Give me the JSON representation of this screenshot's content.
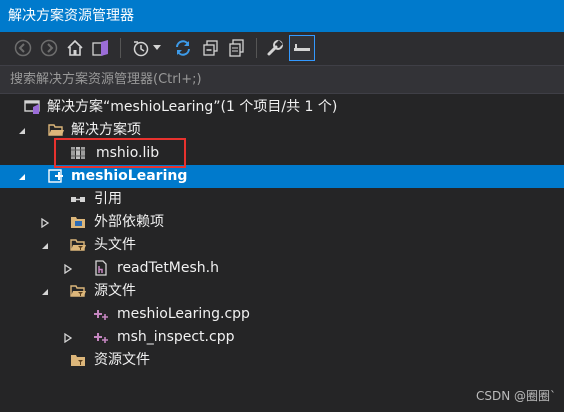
{
  "window": {
    "title": "解决方案资源管理器"
  },
  "toolbar": {
    "buttons": [
      {
        "icon": "back-icon"
      },
      {
        "icon": "forward-icon"
      },
      {
        "icon": "home-icon"
      },
      {
        "icon": "vs-switch-views-icon"
      },
      {
        "icon": "pending-changes-filter-icon"
      },
      {
        "icon": "dropdown-arrow-icon"
      },
      {
        "icon": "sync-icon"
      },
      {
        "icon": "collapse-all-icon"
      },
      {
        "icon": "show-all-files-icon"
      },
      {
        "icon": "properties-wrench-icon"
      },
      {
        "icon": "preview-icon"
      }
    ]
  },
  "search": {
    "placeholder": "搜索解决方案资源管理器(Ctrl+;)"
  },
  "tree": {
    "solution": "解决方案“meshioLearing”(1 个项目/共 1 个)",
    "solution_items_folder": "解决方案项",
    "lib_file": "mshio.lib",
    "project": "meshioLearing",
    "references": "引用",
    "external_deps": "外部依赖项",
    "header_files": "头文件",
    "header_1": "readTetMesh.h",
    "source_files": "源文件",
    "source_1": "meshioLearing.cpp",
    "source_2": "msh_inspect.cpp",
    "resource_files": "资源文件"
  },
  "colors": {
    "accent": "#007acc",
    "background": "#252526",
    "highlight_border": "#e8322e"
  },
  "watermark": "CSDN @圈圈`"
}
